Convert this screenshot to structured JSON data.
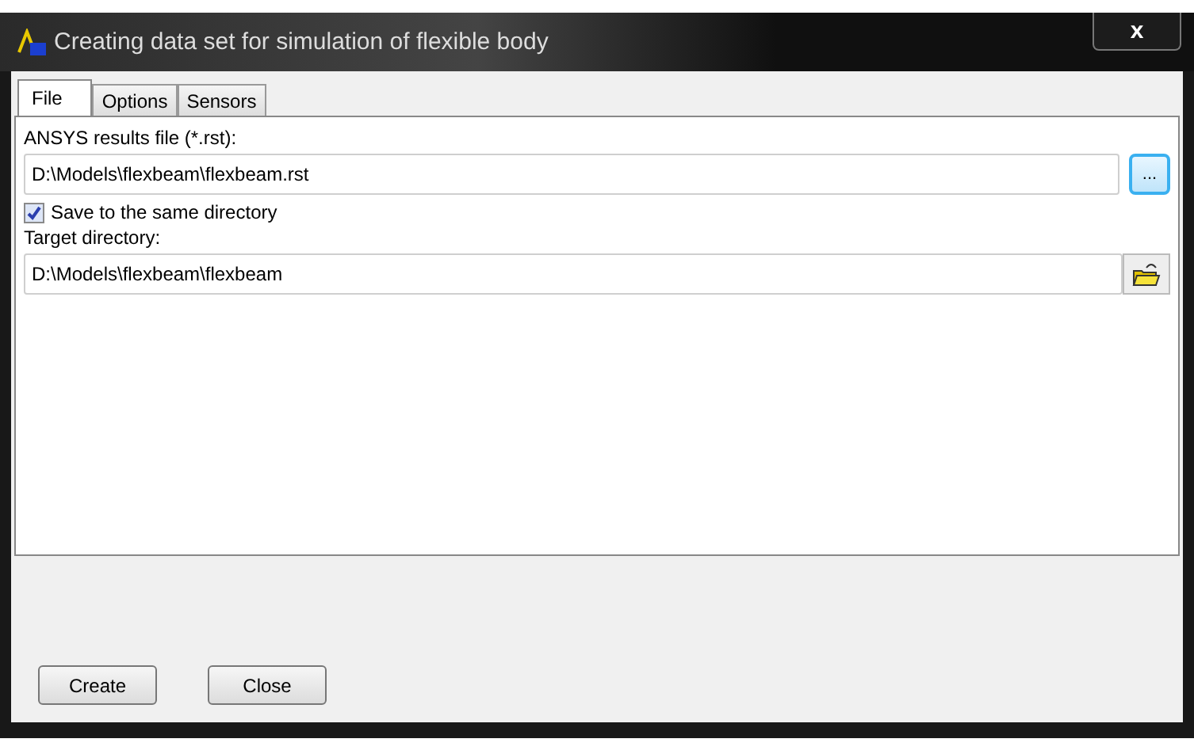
{
  "window": {
    "title": "Creating data set for simulation of flexible body",
    "close": "x"
  },
  "tabs": [
    {
      "label": "File",
      "selected": true
    },
    {
      "label": "Options",
      "selected": false
    },
    {
      "label": "Sensors",
      "selected": false
    }
  ],
  "results_file": {
    "label": "ANSYS results file (*.rst):",
    "value": "D:\\Models\\flexbeam\\flexbeam.rst",
    "browse": "..."
  },
  "same_directory": {
    "label": "Save to the same directory",
    "checked": true
  },
  "target_directory": {
    "label": "Target directory:",
    "value": "D:\\Models\\flexbeam\\flexbeam"
  },
  "buttons": [
    "Create",
    "Close"
  ]
}
